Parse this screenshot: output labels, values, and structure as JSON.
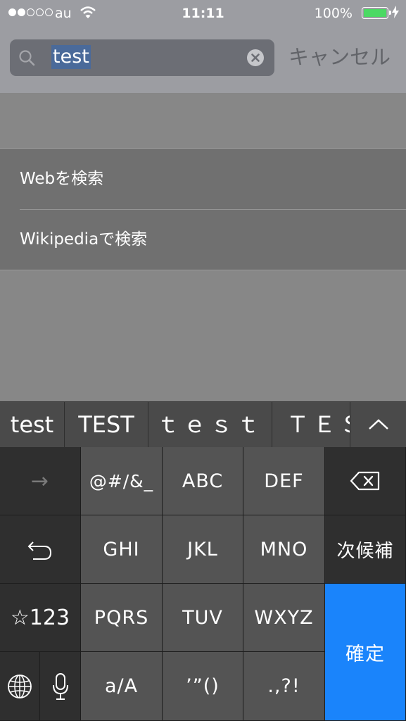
{
  "status_bar": {
    "carrier": "au",
    "signal_bars_filled": 2,
    "signal_bars_total": 5,
    "time": "11:11",
    "battery_percent": "100%",
    "battery_fill": 1.0,
    "battery_color": "#4cd964",
    "icons": [
      "wifi-icon",
      "battery-icon",
      "charging-bolt-icon"
    ]
  },
  "search": {
    "query": "test",
    "cancel_label": "キャンセル",
    "icons": [
      "search-icon",
      "clear-icon"
    ]
  },
  "suggestions": [
    {
      "label": "Webを検索"
    },
    {
      "label": "Wikipediaで検索"
    }
  ],
  "candidates": {
    "items": [
      "test",
      "TEST",
      "ｔｅｓｔ",
      "ＴＥＳ"
    ],
    "expand_icon": "chevron-up-icon"
  },
  "keyboard": {
    "rows": [
      [
        "→",
        "@#/&_",
        "ABC",
        "DEF",
        "delete-icon"
      ],
      [
        "undo-icon",
        "GHI",
        "JKL",
        "MNO",
        "次候補"
      ],
      [
        "☆123",
        "PQRS",
        "TUV",
        "WXYZ",
        "確定"
      ],
      [
        "globe-icon",
        "mic-icon",
        "a/A",
        "'\"()",
        ".,?!"
      ]
    ],
    "labels": {
      "arrow": "→",
      "symbols": "@#/&_",
      "abc": "ABC",
      "def": "DEF",
      "ghi": "GHI",
      "jkl": "JKL",
      "mno": "MNO",
      "next_candidate": "次候補",
      "numbers": "☆123",
      "pqrs": "PQRS",
      "tuv": "TUV",
      "wxyz": "WXYZ",
      "confirm": "確定",
      "case": "a/A",
      "quotes": "’”()",
      "punct": ".,?!"
    },
    "confirm_color": "#1a84fb"
  }
}
